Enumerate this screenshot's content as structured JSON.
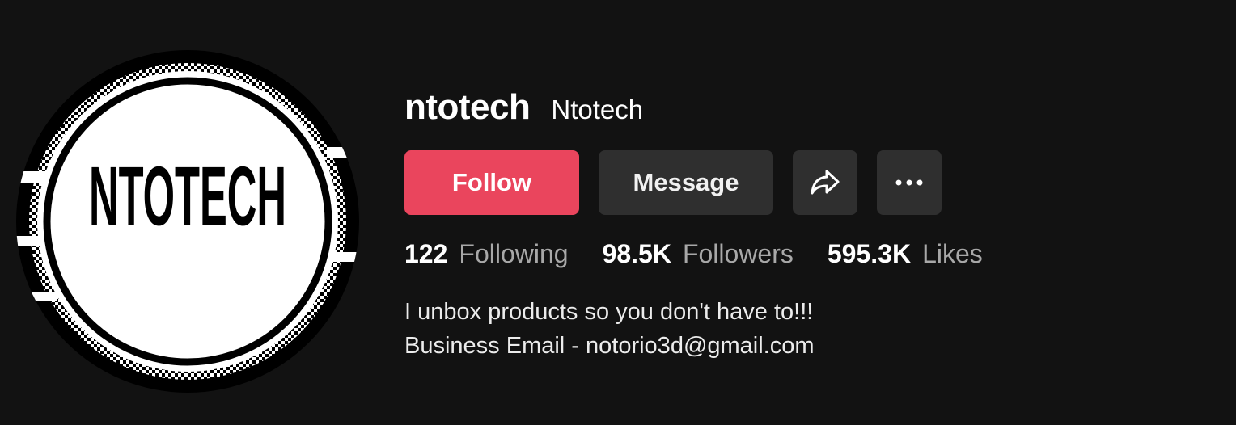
{
  "profile": {
    "avatar_text": "NTOTECH",
    "username": "ntotech",
    "nickname": "Ntotech"
  },
  "actions": {
    "follow_label": "Follow",
    "message_label": "Message",
    "share_icon": "share-icon",
    "more_icon": "more-icon"
  },
  "stats": [
    {
      "value": "122",
      "label": "Following"
    },
    {
      "value": "98.5K",
      "label": "Followers"
    },
    {
      "value": "595.3K",
      "label": "Likes"
    }
  ],
  "bio": {
    "line1": "I unbox products so you don't have to!!!",
    "line2": "Business Email - notorio3d@gmail.com"
  },
  "colors": {
    "background": "#121212",
    "follow": "#ea455d",
    "secondary_button": "#2f2f2f",
    "muted_text": "#a8a8a8"
  }
}
